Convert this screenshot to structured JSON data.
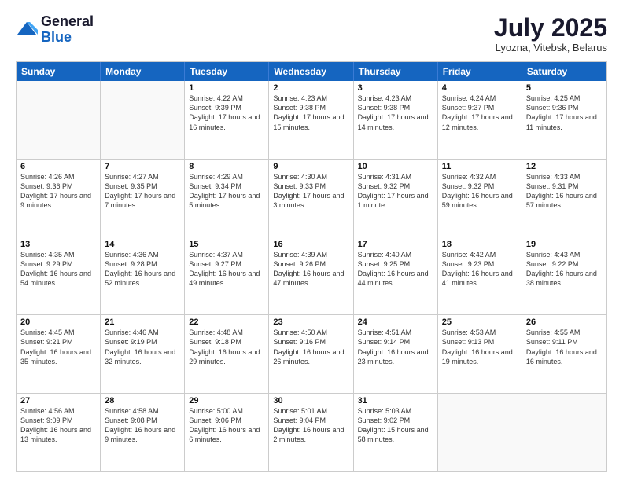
{
  "logo": {
    "general": "General",
    "blue": "Blue"
  },
  "title": "July 2025",
  "location": "Lyozna, Vitebsk, Belarus",
  "header_days": [
    "Sunday",
    "Monday",
    "Tuesday",
    "Wednesday",
    "Thursday",
    "Friday",
    "Saturday"
  ],
  "weeks": [
    [
      {
        "day": "",
        "info": ""
      },
      {
        "day": "",
        "info": ""
      },
      {
        "day": "1",
        "info": "Sunrise: 4:22 AM\nSunset: 9:39 PM\nDaylight: 17 hours and 16 minutes."
      },
      {
        "day": "2",
        "info": "Sunrise: 4:23 AM\nSunset: 9:38 PM\nDaylight: 17 hours and 15 minutes."
      },
      {
        "day": "3",
        "info": "Sunrise: 4:23 AM\nSunset: 9:38 PM\nDaylight: 17 hours and 14 minutes."
      },
      {
        "day": "4",
        "info": "Sunrise: 4:24 AM\nSunset: 9:37 PM\nDaylight: 17 hours and 12 minutes."
      },
      {
        "day": "5",
        "info": "Sunrise: 4:25 AM\nSunset: 9:36 PM\nDaylight: 17 hours and 11 minutes."
      }
    ],
    [
      {
        "day": "6",
        "info": "Sunrise: 4:26 AM\nSunset: 9:36 PM\nDaylight: 17 hours and 9 minutes."
      },
      {
        "day": "7",
        "info": "Sunrise: 4:27 AM\nSunset: 9:35 PM\nDaylight: 17 hours and 7 minutes."
      },
      {
        "day": "8",
        "info": "Sunrise: 4:29 AM\nSunset: 9:34 PM\nDaylight: 17 hours and 5 minutes."
      },
      {
        "day": "9",
        "info": "Sunrise: 4:30 AM\nSunset: 9:33 PM\nDaylight: 17 hours and 3 minutes."
      },
      {
        "day": "10",
        "info": "Sunrise: 4:31 AM\nSunset: 9:32 PM\nDaylight: 17 hours and 1 minute."
      },
      {
        "day": "11",
        "info": "Sunrise: 4:32 AM\nSunset: 9:32 PM\nDaylight: 16 hours and 59 minutes."
      },
      {
        "day": "12",
        "info": "Sunrise: 4:33 AM\nSunset: 9:31 PM\nDaylight: 16 hours and 57 minutes."
      }
    ],
    [
      {
        "day": "13",
        "info": "Sunrise: 4:35 AM\nSunset: 9:29 PM\nDaylight: 16 hours and 54 minutes."
      },
      {
        "day": "14",
        "info": "Sunrise: 4:36 AM\nSunset: 9:28 PM\nDaylight: 16 hours and 52 minutes."
      },
      {
        "day": "15",
        "info": "Sunrise: 4:37 AM\nSunset: 9:27 PM\nDaylight: 16 hours and 49 minutes."
      },
      {
        "day": "16",
        "info": "Sunrise: 4:39 AM\nSunset: 9:26 PM\nDaylight: 16 hours and 47 minutes."
      },
      {
        "day": "17",
        "info": "Sunrise: 4:40 AM\nSunset: 9:25 PM\nDaylight: 16 hours and 44 minutes."
      },
      {
        "day": "18",
        "info": "Sunrise: 4:42 AM\nSunset: 9:23 PM\nDaylight: 16 hours and 41 minutes."
      },
      {
        "day": "19",
        "info": "Sunrise: 4:43 AM\nSunset: 9:22 PM\nDaylight: 16 hours and 38 minutes."
      }
    ],
    [
      {
        "day": "20",
        "info": "Sunrise: 4:45 AM\nSunset: 9:21 PM\nDaylight: 16 hours and 35 minutes."
      },
      {
        "day": "21",
        "info": "Sunrise: 4:46 AM\nSunset: 9:19 PM\nDaylight: 16 hours and 32 minutes."
      },
      {
        "day": "22",
        "info": "Sunrise: 4:48 AM\nSunset: 9:18 PM\nDaylight: 16 hours and 29 minutes."
      },
      {
        "day": "23",
        "info": "Sunrise: 4:50 AM\nSunset: 9:16 PM\nDaylight: 16 hours and 26 minutes."
      },
      {
        "day": "24",
        "info": "Sunrise: 4:51 AM\nSunset: 9:14 PM\nDaylight: 16 hours and 23 minutes."
      },
      {
        "day": "25",
        "info": "Sunrise: 4:53 AM\nSunset: 9:13 PM\nDaylight: 16 hours and 19 minutes."
      },
      {
        "day": "26",
        "info": "Sunrise: 4:55 AM\nSunset: 9:11 PM\nDaylight: 16 hours and 16 minutes."
      }
    ],
    [
      {
        "day": "27",
        "info": "Sunrise: 4:56 AM\nSunset: 9:09 PM\nDaylight: 16 hours and 13 minutes."
      },
      {
        "day": "28",
        "info": "Sunrise: 4:58 AM\nSunset: 9:08 PM\nDaylight: 16 hours and 9 minutes."
      },
      {
        "day": "29",
        "info": "Sunrise: 5:00 AM\nSunset: 9:06 PM\nDaylight: 16 hours and 6 minutes."
      },
      {
        "day": "30",
        "info": "Sunrise: 5:01 AM\nSunset: 9:04 PM\nDaylight: 16 hours and 2 minutes."
      },
      {
        "day": "31",
        "info": "Sunrise: 5:03 AM\nSunset: 9:02 PM\nDaylight: 15 hours and 58 minutes."
      },
      {
        "day": "",
        "info": ""
      },
      {
        "day": "",
        "info": ""
      }
    ]
  ]
}
